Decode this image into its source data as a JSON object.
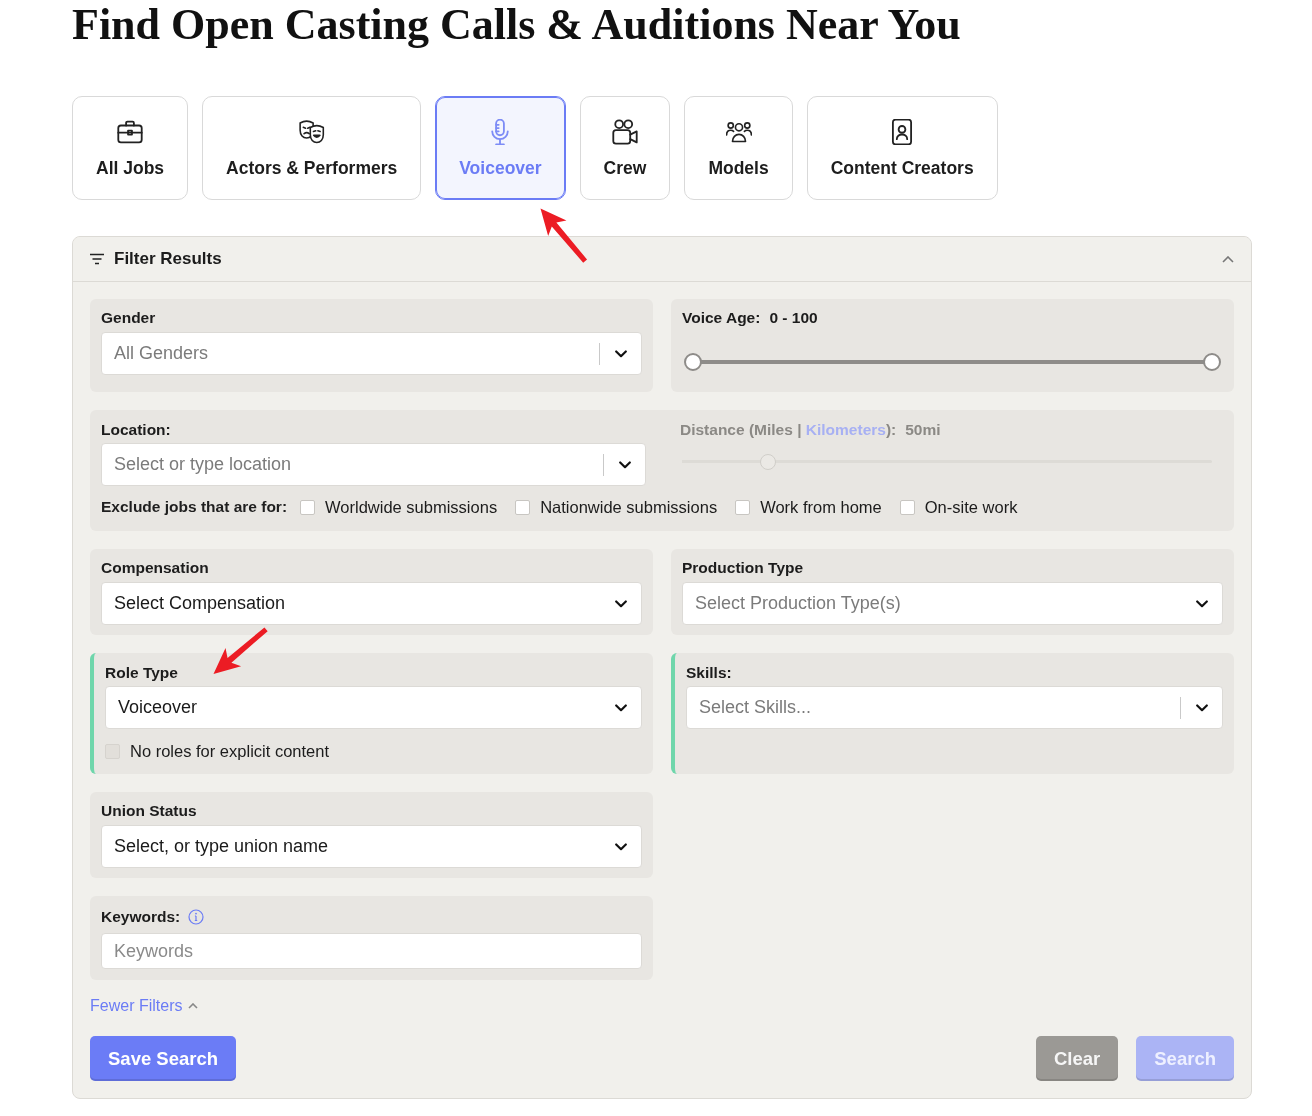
{
  "page": {
    "title": "Find Open Casting Calls & Auditions Near You"
  },
  "categories": [
    {
      "label": "All Jobs",
      "selected": false
    },
    {
      "label": "Actors & Performers",
      "selected": false
    },
    {
      "label": "Voiceover",
      "selected": true
    },
    {
      "label": "Crew",
      "selected": false
    },
    {
      "label": "Models",
      "selected": false
    },
    {
      "label": "Content Creators",
      "selected": false
    }
  ],
  "filter": {
    "title": "Filter Results",
    "expanded": true,
    "gender": {
      "label": "Gender",
      "placeholder": "All Genders",
      "kind": "combo"
    },
    "voice_age": {
      "label": "Voice Age:",
      "reading": "0 - 100",
      "thumbs": [
        {
          "level": 0
        },
        {
          "level": 1
        }
      ]
    },
    "location": {
      "label": "Location:",
      "placeholder": "Select or type location",
      "kind": "combo"
    },
    "distance": {
      "label": "Distance (Miles | ",
      "link": "Kilometers",
      "label_end": "):",
      "reading": "50mi",
      "disabled": true,
      "level": 0.15
    },
    "exclude": {
      "label": "Exclude jobs that are for:",
      "options": [
        {
          "label": "Worldwide submissions",
          "checked": false
        },
        {
          "label": "Nationwide submissions",
          "checked": false
        },
        {
          "label": "Work from home",
          "checked": false
        },
        {
          "label": "On-site work",
          "checked": false
        }
      ]
    },
    "compensation": {
      "label": "Compensation",
      "value": "Select Compensation",
      "kind": "select"
    },
    "production_type": {
      "label": "Production Type",
      "placeholder": "Select Production Type(s)",
      "kind": "select"
    },
    "role_type": {
      "label": "Role Type",
      "value": "Voiceover",
      "kind": "select",
      "highlighted": true,
      "explicit": {
        "label": "No roles for explicit content",
        "checked": false,
        "disabled": true
      }
    },
    "skills": {
      "label": "Skills:",
      "placeholder": "Select Skills...",
      "kind": "combo",
      "highlighted": true
    },
    "union_status": {
      "label": "Union Status",
      "value": "Select, or type union name",
      "kind": "select"
    },
    "keywords": {
      "label": "Keywords:",
      "placeholder": "Keywords",
      "info": true
    },
    "fewer_filters": {
      "label": "Fewer Filters"
    },
    "buttons": [
      {
        "label": "Save Search",
        "kind": "primary",
        "disabled": false
      },
      {
        "label": "Clear",
        "kind": "secondary",
        "disabled": false
      },
      {
        "label": "Search",
        "kind": "primary",
        "disabled": true
      }
    ]
  }
}
